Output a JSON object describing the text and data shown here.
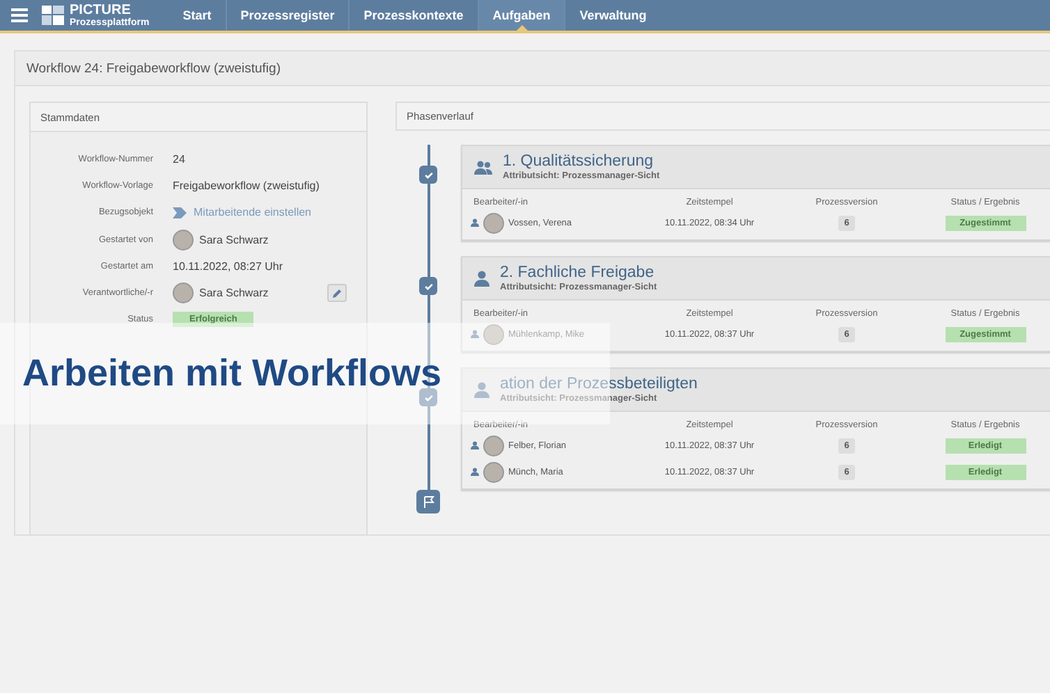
{
  "nav": {
    "brand_title": "PICTURE",
    "brand_subtitle": "Prozessplattform",
    "items": [
      {
        "label": "Start",
        "selected": false
      },
      {
        "label": "Prozessregister",
        "selected": false
      },
      {
        "label": "Prozesskontexte",
        "selected": false
      },
      {
        "label": "Aufgaben",
        "selected": true
      },
      {
        "label": "Verwaltung",
        "selected": false
      }
    ]
  },
  "page_title": "Workflow 24: Freigabeworkflow (zweistufig)",
  "master_data": {
    "title": "Stammdaten",
    "fields": [
      {
        "kind": "text",
        "label": "Workflow-Nummer",
        "value": "24"
      },
      {
        "kind": "text",
        "label": "Workflow-Vorlage",
        "value": "Freigabeworkflow (zweistufig)"
      },
      {
        "kind": "link",
        "label": "Bezugsobjekt",
        "value": "Mitarbeitende einstellen"
      },
      {
        "kind": "person",
        "label": "Gestartet von",
        "value": "Sara Schwarz"
      },
      {
        "kind": "text",
        "label": "Gestartet am",
        "value": "10.11.2022, 08:27 Uhr"
      },
      {
        "kind": "person_editable",
        "label": "Verantwortliche/-r",
        "value": "Sara Schwarz"
      },
      {
        "kind": "status",
        "label": "Status",
        "value": "Erfolgreich"
      }
    ]
  },
  "phases": {
    "title": "Phasenverlauf",
    "items": [
      {
        "kind": "group",
        "title": "1. Qualitätssicherung",
        "subtitle": "Attributsicht: Prozessmanager-Sicht",
        "done": true,
        "columns": [
          "Bearbeiter/-in",
          "Zeitstempel",
          "Prozessversion",
          "Status / Ergebnis"
        ],
        "rows": [
          {
            "person": "Vossen, Verena",
            "timestamp": "10.11.2022, 08:34 Uhr",
            "version": "6",
            "status": "Zugestimmt"
          }
        ]
      },
      {
        "kind": "single",
        "title": "2. Fachliche Freigabe",
        "subtitle": "Attributsicht: Prozessmanager-Sicht",
        "done": true,
        "columns": [
          "Bearbeiter/-in",
          "Zeitstempel",
          "Prozessversion",
          "Status / Ergebnis"
        ],
        "rows": [
          {
            "person": "Mühlenkamp, Mike",
            "timestamp": "10.11.2022, 08:37 Uhr",
            "version": "6",
            "status": "Zugestimmt"
          }
        ]
      },
      {
        "kind": "single",
        "title": "ation der Prozessbeteiligten",
        "subtitle": "Attributsicht: Prozessmanager-Sicht",
        "done": true,
        "columns": [
          "Bearbeiter/-in",
          "Zeitstempel",
          "Prozessversion",
          "Status / Ergebnis"
        ],
        "rows": [
          {
            "person": "Felber, Florian",
            "timestamp": "10.11.2022, 08:37 Uhr",
            "version": "6",
            "status": "Erledigt"
          },
          {
            "person": "Münch, Maria",
            "timestamp": "10.11.2022, 08:37 Uhr",
            "version": "6",
            "status": "Erledigt"
          }
        ]
      }
    ]
  },
  "banner": {
    "title": "Arbeiten mit Workflows"
  }
}
